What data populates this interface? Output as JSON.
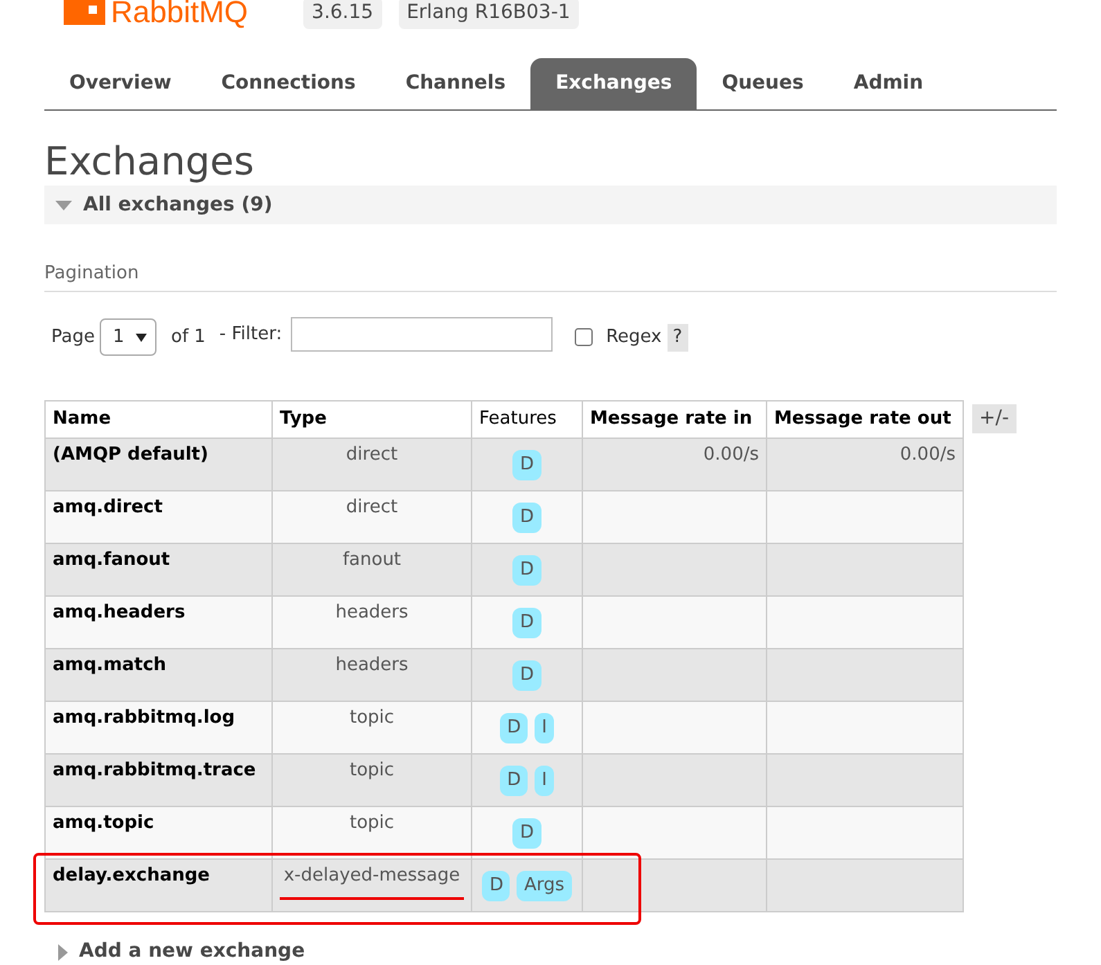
{
  "header": {
    "logo": "RabbitMQ",
    "version": "3.6.15",
    "erlang": "Erlang R16B03-1"
  },
  "tabs": [
    {
      "label": "Overview",
      "selected": false
    },
    {
      "label": "Connections",
      "selected": false
    },
    {
      "label": "Channels",
      "selected": false
    },
    {
      "label": "Exchanges",
      "selected": true
    },
    {
      "label": "Queues",
      "selected": false
    },
    {
      "label": "Admin",
      "selected": false
    }
  ],
  "page_title": "Exchanges",
  "section": {
    "title": "All exchanges (9)",
    "expanded": true
  },
  "pagination": {
    "heading": "Pagination",
    "page_label": "Page",
    "page_value": "1",
    "of_label": "of 1",
    "filter_label": "- Filter:",
    "regex_label": "Regex",
    "regex_checked": false,
    "help": "?"
  },
  "table": {
    "columns": [
      "Name",
      "Type",
      "Features",
      "Message rate in",
      "Message rate out"
    ],
    "toggle": "+/-",
    "rows": [
      {
        "name": "(AMQP default)",
        "type": "direct",
        "features": [
          "D"
        ],
        "rate_in": "0.00/s",
        "rate_out": "0.00/s",
        "highlighted": false
      },
      {
        "name": "amq.direct",
        "type": "direct",
        "features": [
          "D"
        ],
        "highlighted": false
      },
      {
        "name": "amq.fanout",
        "type": "fanout",
        "features": [
          "D"
        ],
        "highlighted": false
      },
      {
        "name": "amq.headers",
        "type": "headers",
        "features": [
          "D"
        ],
        "highlighted": false
      },
      {
        "name": "amq.match",
        "type": "headers",
        "features": [
          "D"
        ],
        "highlighted": false
      },
      {
        "name": "amq.rabbitmq.log",
        "type": "topic",
        "features": [
          "D",
          "I"
        ],
        "highlighted": false
      },
      {
        "name": "amq.rabbitmq.trace",
        "type": "topic",
        "features": [
          "D",
          "I"
        ],
        "highlighted": false
      },
      {
        "name": "amq.topic",
        "type": "topic",
        "features": [
          "D"
        ],
        "highlighted": false
      },
      {
        "name": "delay.exchange",
        "type": "x-delayed-message",
        "features": [
          "D",
          "Args"
        ],
        "highlighted": true
      }
    ]
  },
  "add_section": {
    "title": "Add a new exchange",
    "expanded": false
  }
}
